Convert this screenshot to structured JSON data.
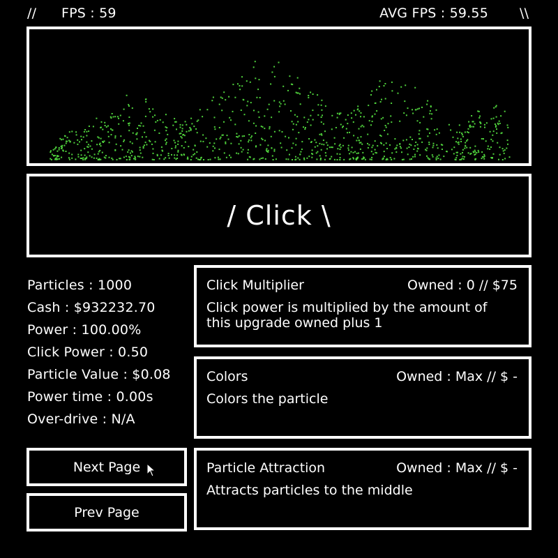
{
  "topbar": {
    "left_marker": "//",
    "fps": "FPS : 59",
    "avg_fps": "AVG FPS : 59.55",
    "right_marker": "\\\\"
  },
  "particle_color": "#4fd13c",
  "click_button": {
    "label": "/ Click \\"
  },
  "stats": [
    "Particles : 1000",
    "Cash : $932232.70",
    "Power : 100.00%",
    "Click Power : 0.50",
    "Particle Value : $0.08",
    "Power time : 0.00s",
    "Over-drive : N/A"
  ],
  "nav": {
    "next": "Next Page",
    "prev": "Prev Page"
  },
  "upgrades": [
    {
      "name": "Click Multiplier",
      "owned": "Owned : 0 // $75",
      "desc": "Click power is multiplied by the amount of this upgrade owned plus 1"
    },
    {
      "name": "Colors",
      "owned": "Owned : Max // $ -",
      "desc": "Colors the particle"
    },
    {
      "name": "Particle Attraction",
      "owned": "Owned : Max // $ -",
      "desc": "Attracts particles to the middle"
    }
  ]
}
